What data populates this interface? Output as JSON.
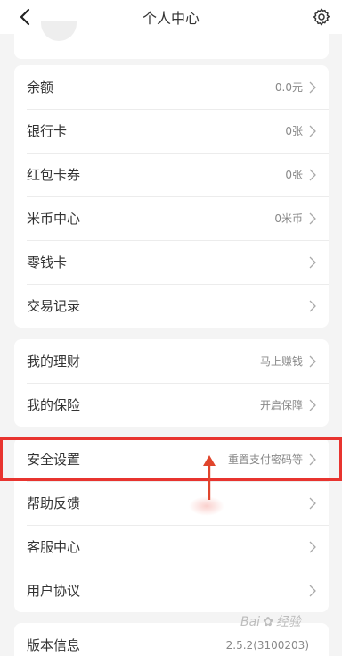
{
  "header": {
    "title": "个人中心",
    "back_icon": "back-chevron-icon",
    "settings_icon": "gear-icon"
  },
  "section_wallet": {
    "items": [
      {
        "label": "余额",
        "value": "0.0元"
      },
      {
        "label": "银行卡",
        "value": "0张"
      },
      {
        "label": "红包卡券",
        "value": "0张"
      },
      {
        "label": "米币中心",
        "value": "0米币"
      },
      {
        "label": "零钱卡",
        "value": ""
      },
      {
        "label": "交易记录",
        "value": ""
      }
    ]
  },
  "section_finance": {
    "items": [
      {
        "label": "我的理财",
        "value": "马上赚钱"
      },
      {
        "label": "我的保险",
        "value": "开启保障"
      }
    ]
  },
  "section_settings": {
    "items": [
      {
        "label": "安全设置",
        "value": "重置支付密码等"
      },
      {
        "label": "帮助反馈",
        "value": ""
      },
      {
        "label": "客服中心",
        "value": ""
      },
      {
        "label": "用户协议",
        "value": ""
      }
    ]
  },
  "section_version": {
    "label": "版本信息",
    "value": "2.5.2(3100203)"
  },
  "annotation": {
    "highlight_color": "#e8342f"
  },
  "watermark": {
    "text_left": "Bai",
    "text_right": "经验"
  }
}
